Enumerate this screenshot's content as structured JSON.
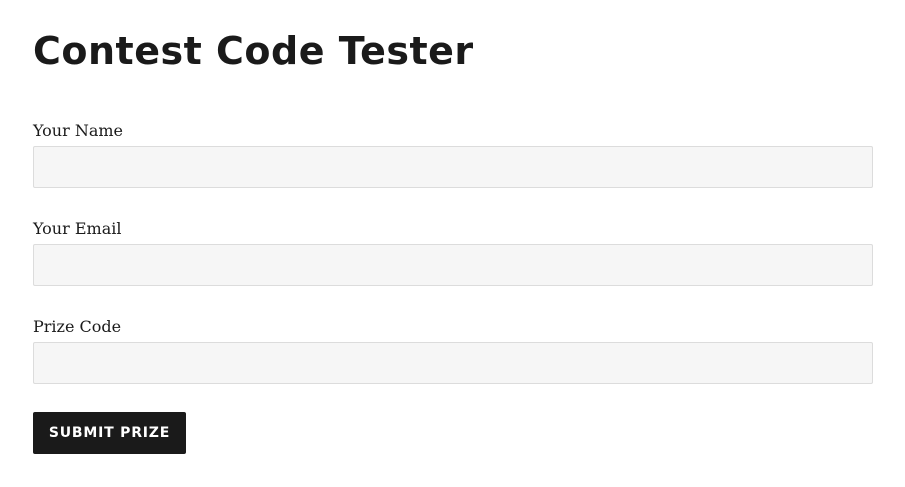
{
  "page": {
    "title": "Contest Code Tester"
  },
  "form": {
    "fields": [
      {
        "label": "Your Name",
        "value": "",
        "placeholder": ""
      },
      {
        "label": "Your Email",
        "value": "",
        "placeholder": ""
      },
      {
        "label": "Prize Code",
        "value": "",
        "placeholder": ""
      }
    ],
    "submit_label": "SUBMIT PRIZE"
  },
  "colors": {
    "text": "#1a1a1a",
    "input_background": "#f6f6f6",
    "input_border": "#dcdcdc",
    "button_background": "#1a1a1a",
    "button_text": "#ffffff"
  }
}
